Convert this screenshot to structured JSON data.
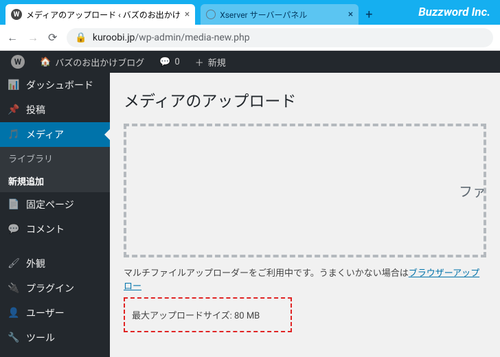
{
  "tabs": [
    {
      "label": "メディアのアップロード ‹ バズのお出かけ"
    },
    {
      "label": "Xserver サーバーパネル"
    }
  ],
  "brand": "Buzzword Inc.",
  "url": {
    "host": "kuroobi.jp",
    "path": "/wp-admin/media-new.php"
  },
  "adminbar": {
    "site": "バズのお出かけブログ",
    "comments": "0",
    "new": "新規"
  },
  "sidebar": {
    "dashboard": "ダッシュボード",
    "posts": "投稿",
    "media": "メディア",
    "media_sub": {
      "library": "ライブラリ",
      "add_new": "新規追加"
    },
    "pages": "固定ページ",
    "comments": "コメント",
    "appearance": "外観",
    "plugins": "プラグイン",
    "users": "ユーザー",
    "tools": "ツール"
  },
  "content": {
    "title": "メディアのアップロード",
    "dropzone_text": "ファ",
    "multi_note_prefix": "マルチファイルアップローダーをご利用中です。うまくいかない場合は",
    "multi_note_link": "ブラウザーアップロー",
    "max_upload": "最大アップロードサイズ: 80 MB"
  }
}
